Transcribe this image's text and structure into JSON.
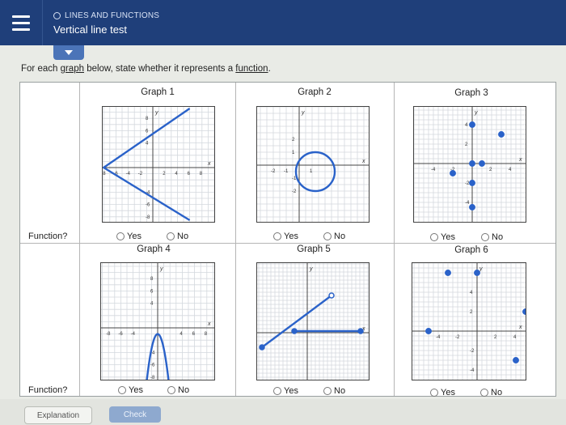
{
  "header": {
    "topic": "LINES AND FUNCTIONS",
    "title": "Vertical line test"
  },
  "instruction": {
    "prefix": "For each ",
    "link": "graph",
    "middle": " below, state whether it represents a ",
    "link2": "function",
    "suffix": "."
  },
  "row_label": "Function?",
  "answer_yes": "Yes",
  "answer_no": "No",
  "graphs": [
    {
      "caption": "Graph 1",
      "x_ticks": [
        "-8",
        "-6",
        "-4",
        "-2",
        "2",
        "4",
        "6",
        "8"
      ],
      "y_ticks": [
        "8",
        "6",
        "4",
        "-4",
        "-6",
        "-8"
      ]
    },
    {
      "caption": "Graph 2",
      "x_ticks": [
        "-2",
        "-1",
        "1"
      ],
      "y_ticks": [
        "2",
        "1",
        "-1",
        "-2"
      ]
    },
    {
      "caption": "Graph 3",
      "x_ticks": [
        "-4",
        "-2",
        "2",
        "4"
      ],
      "y_ticks": [
        "4",
        "2",
        "-2",
        "-4"
      ]
    },
    {
      "caption": "Graph 4",
      "x_ticks": [
        "-8",
        "-6",
        "-4",
        "4",
        "6",
        "8"
      ],
      "y_ticks": [
        "8",
        "6",
        "4",
        "-4",
        "-6",
        "-8"
      ]
    },
    {
      "caption": "Graph 5",
      "x_ticks": [],
      "y_ticks": []
    },
    {
      "caption": "Graph 6",
      "x_ticks": [
        "-4",
        "-2",
        "2",
        "4"
      ],
      "y_ticks": [
        "4",
        "2",
        "-2",
        "-4"
      ]
    }
  ],
  "buttons": {
    "explanation": "Explanation",
    "check": "Check"
  },
  "colors": {
    "header_bg": "#1f3f7a",
    "graph_blue": "#2a62c9"
  }
}
